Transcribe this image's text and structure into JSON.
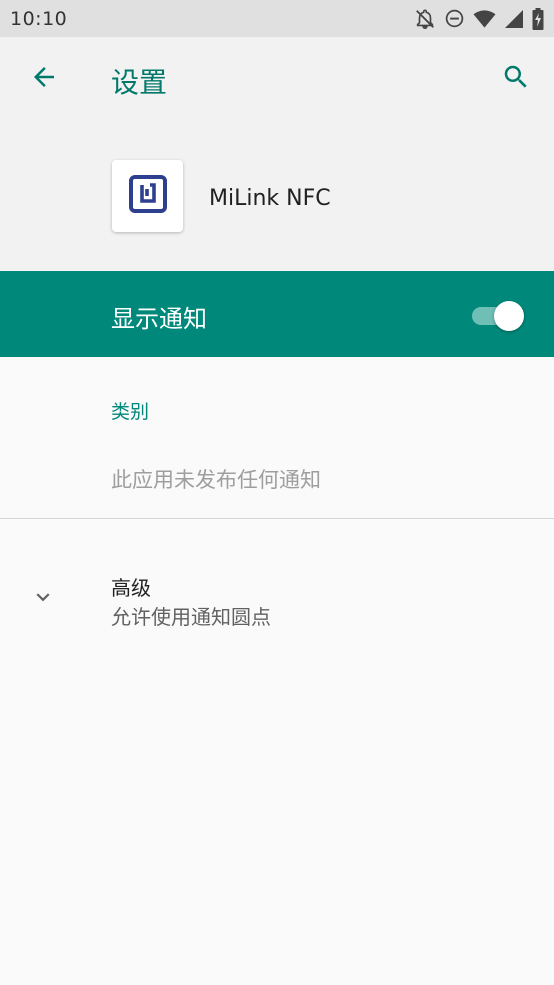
{
  "status_bar": {
    "time": "10:10",
    "icons": [
      "notifications-off-icon",
      "do-not-disturb-icon",
      "wifi-icon",
      "signal-icon",
      "battery-charging-icon"
    ]
  },
  "app_bar": {
    "title": "设置",
    "back_icon": "arrow-back-icon",
    "search_icon": "search-icon"
  },
  "app_header": {
    "app_name": "MiLink NFC",
    "icon": "nfc-icon"
  },
  "notifications": {
    "label": "显示通知",
    "enabled": true
  },
  "category": {
    "header": "类别",
    "empty_text": "此应用未发布任何通知"
  },
  "advanced": {
    "title": "高级",
    "subtitle": "允许使用通知圆点"
  },
  "colors": {
    "accent": "#00897b",
    "accent_dark": "#00796b",
    "icon_blue": "#2f3f8f"
  }
}
